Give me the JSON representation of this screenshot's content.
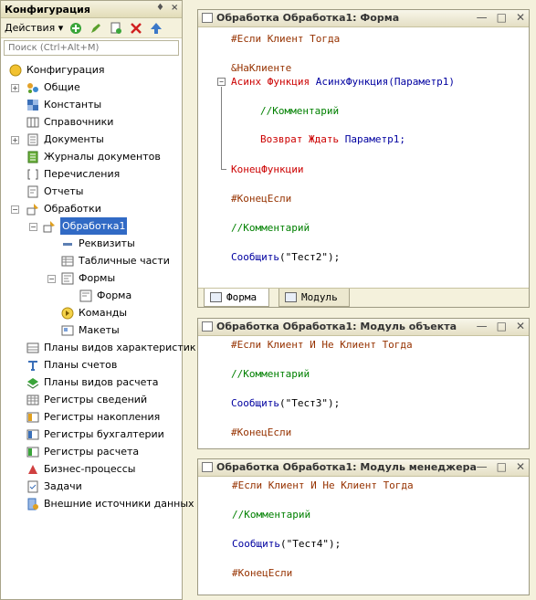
{
  "config_panel": {
    "title": "Конфигурация",
    "pin_glyph": "♦",
    "close_glyph": "×",
    "actions_label": "Действия ▾",
    "search_placeholder": "Поиск (Ctrl+Alt+M)",
    "toolbar_icons": [
      "add-icon",
      "edit-icon",
      "copy-icon",
      "delete-icon",
      "up-icon"
    ],
    "tree": {
      "root": "Конфигурация",
      "general": "Общие",
      "constants": "Константы",
      "catalogs": "Справочники",
      "documents": "Документы",
      "journals": "Журналы документов",
      "enums": "Перечисления",
      "reports": "Отчеты",
      "dataprocessors": "Обработки",
      "dp1": "Обработка1",
      "attributes": "Реквизиты",
      "tabular": "Табличные части",
      "forms": "Формы",
      "form": "Форма",
      "commands": "Команды",
      "templates": "Макеты",
      "char_types": "Планы видов характеристик",
      "accounts": "Планы счетов",
      "calc_types": "Планы видов расчета",
      "info_registers": "Регистры сведений",
      "accum_registers": "Регистры накопления",
      "acc_registers": "Регистры бухгалтерии",
      "calc_registers": "Регистры расчета",
      "business_processes": "Бизнес-процессы",
      "tasks": "Задачи",
      "external_sources": "Внешние источники данных"
    }
  },
  "form_window": {
    "title": "Обработка Обработка1: Форма",
    "lines": {
      "l1": "#Если Клиент Тогда",
      "l2": "&НаКлиенте",
      "l3_kw": "Асинх Функция ",
      "l3_fn": "АсинхФункция",
      "l3_rest": "(Параметр1)",
      "l4": "//Комментарий",
      "l5_kw": "Возврат Ждать ",
      "l5_rest": "Параметр1;",
      "l6": "КонецФункции",
      "l7": "#КонецЕсли",
      "l8": "//Комментарий",
      "l9_fn": "Сообщить",
      "l9_rest": "(\"Тест2\");"
    },
    "tab_form": "Форма",
    "tab_module": "Модуль"
  },
  "object_module_window": {
    "title": "Обработка Обработка1: Модуль объекта",
    "lines": {
      "l1": "#Если Клиент И Не Клиент Тогда",
      "l2": "//Комментарий",
      "l3_fn": "Сообщить",
      "l3_rest": "(\"Тест3\");",
      "l4": "#КонецЕсли"
    }
  },
  "manager_module_window": {
    "title": "Обработка Обработка1: Модуль менеджера",
    "lines": {
      "l1": "#Если Клиент И Не Клиент Тогда",
      "l2": "//Комментарий",
      "l3_fn": "Сообщить",
      "l3_rest": "(\"Тест4\");",
      "l4": "#КонецЕсли"
    }
  },
  "window_buttons": {
    "minimize": "—",
    "maximize": "□",
    "close": "✕"
  },
  "colors": {
    "keyword": "#cc0000",
    "comment": "#008000",
    "function": "#0000a0",
    "preprocessor": "#963200",
    "selection": "#316ac5"
  }
}
